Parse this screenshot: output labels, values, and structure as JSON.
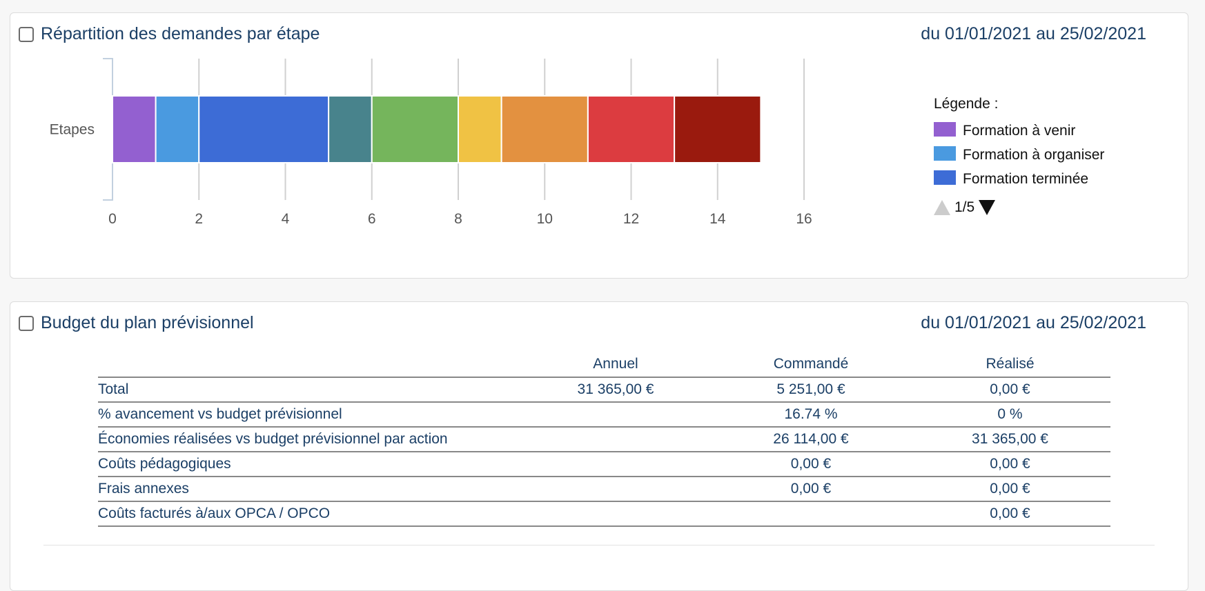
{
  "chart_panel": {
    "title": "Répartition des demandes par étape",
    "date_range": "du 01/01/2021 au 25/02/2021",
    "legend": {
      "title": "Légende :",
      "pager": "1/5",
      "items": [
        {
          "label": "Formation à venir",
          "color": "#9360d0"
        },
        {
          "label": "Formation à organiser",
          "color": "#4a9ae0"
        },
        {
          "label": "Formation terminée",
          "color": "#3d6cd6"
        }
      ]
    }
  },
  "chart_data": {
    "type": "bar",
    "orientation": "horizontal",
    "stacked": true,
    "categories": [
      "Etapes"
    ],
    "x_ticks": [
      "0",
      "2",
      "4",
      "6",
      "8",
      "10",
      "12",
      "14",
      "16"
    ],
    "xlim": [
      0,
      16
    ],
    "grid": true,
    "legend_position": "right",
    "series": [
      {
        "name": "Formation à venir",
        "values": [
          1
        ],
        "color": "#9360d0"
      },
      {
        "name": "Formation à organiser",
        "values": [
          1
        ],
        "color": "#4a9ae0"
      },
      {
        "name": "Formation terminée",
        "values": [
          3
        ],
        "color": "#3d6cd6"
      },
      {
        "values": [
          1
        ],
        "color": "#48838c"
      },
      {
        "values": [
          2
        ],
        "color": "#75b55c"
      },
      {
        "values": [
          1
        ],
        "color": "#f0c244"
      },
      {
        "values": [
          2
        ],
        "color": "#e39140"
      },
      {
        "values": [
          2
        ],
        "color": "#dc3c40"
      },
      {
        "values": [
          2
        ],
        "color": "#9a1a0e"
      }
    ]
  },
  "budget_panel": {
    "title": "Budget du plan prévisionnel",
    "date_range": "du 01/01/2021 au 25/02/2021",
    "columns": [
      "",
      "Annuel",
      "Commandé",
      "Réalisé"
    ],
    "rows": [
      {
        "label": "Total",
        "annuel": "31 365,00 €",
        "commande": "5 251,00 €",
        "realise": "0,00 €"
      },
      {
        "label": "% avancement vs budget prévisionnel",
        "annuel": "",
        "commande": "16.74 %",
        "realise": "0 %"
      },
      {
        "label": "Économies réalisées vs budget prévisionnel par action",
        "annuel": "",
        "commande": "26 114,00 €",
        "realise": "31 365,00 €"
      },
      {
        "label": "Coûts pédagogiques",
        "annuel": "",
        "commande": "0,00 €",
        "realise": "0,00 €"
      },
      {
        "label": "Frais annexes",
        "annuel": "",
        "commande": "0,00 €",
        "realise": "0,00 €"
      },
      {
        "label": "Coûts facturés à/aux OPCA / OPCO",
        "annuel": "",
        "commande": "",
        "realise": "0,00 €"
      }
    ]
  }
}
